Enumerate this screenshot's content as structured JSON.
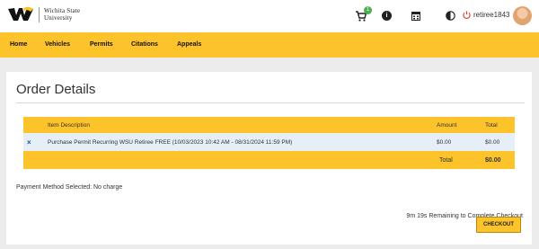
{
  "header": {
    "university_name_line1": "Wichita State",
    "university_name_line2": "University",
    "cart_count": "1",
    "username": "retiree1843",
    "icons": [
      "cart-icon",
      "info-icon",
      "calendar-icon",
      "contrast-icon",
      "logout-icon",
      "avatar"
    ]
  },
  "nav": {
    "items": [
      "Home",
      "Vehicles",
      "Permits",
      "Citations",
      "Appeals"
    ]
  },
  "main": {
    "title": "Order Details",
    "table": {
      "headers": {
        "item": "Item Description",
        "amount": "Amount",
        "total": "Total"
      },
      "rows": [
        {
          "remove": "×",
          "description": "Purchase Permit Recurring WSU Retiree FREE (10/03/2023 10:42 AM - 08/31/2024 11:59 PM)",
          "amount": "$0.00",
          "total": "$0.00"
        }
      ],
      "footer": {
        "label": "Total",
        "value": "$0.00"
      }
    },
    "payment_method": "Payment Method Selected: No charge",
    "remaining": "9m 19s Remaining to Complete Checkout",
    "checkout_label": "CHECKOUT"
  },
  "colors": {
    "brand_yellow": "#fdc32b",
    "row_blue": "#e6eef7",
    "badge_green": "#4caf50"
  }
}
